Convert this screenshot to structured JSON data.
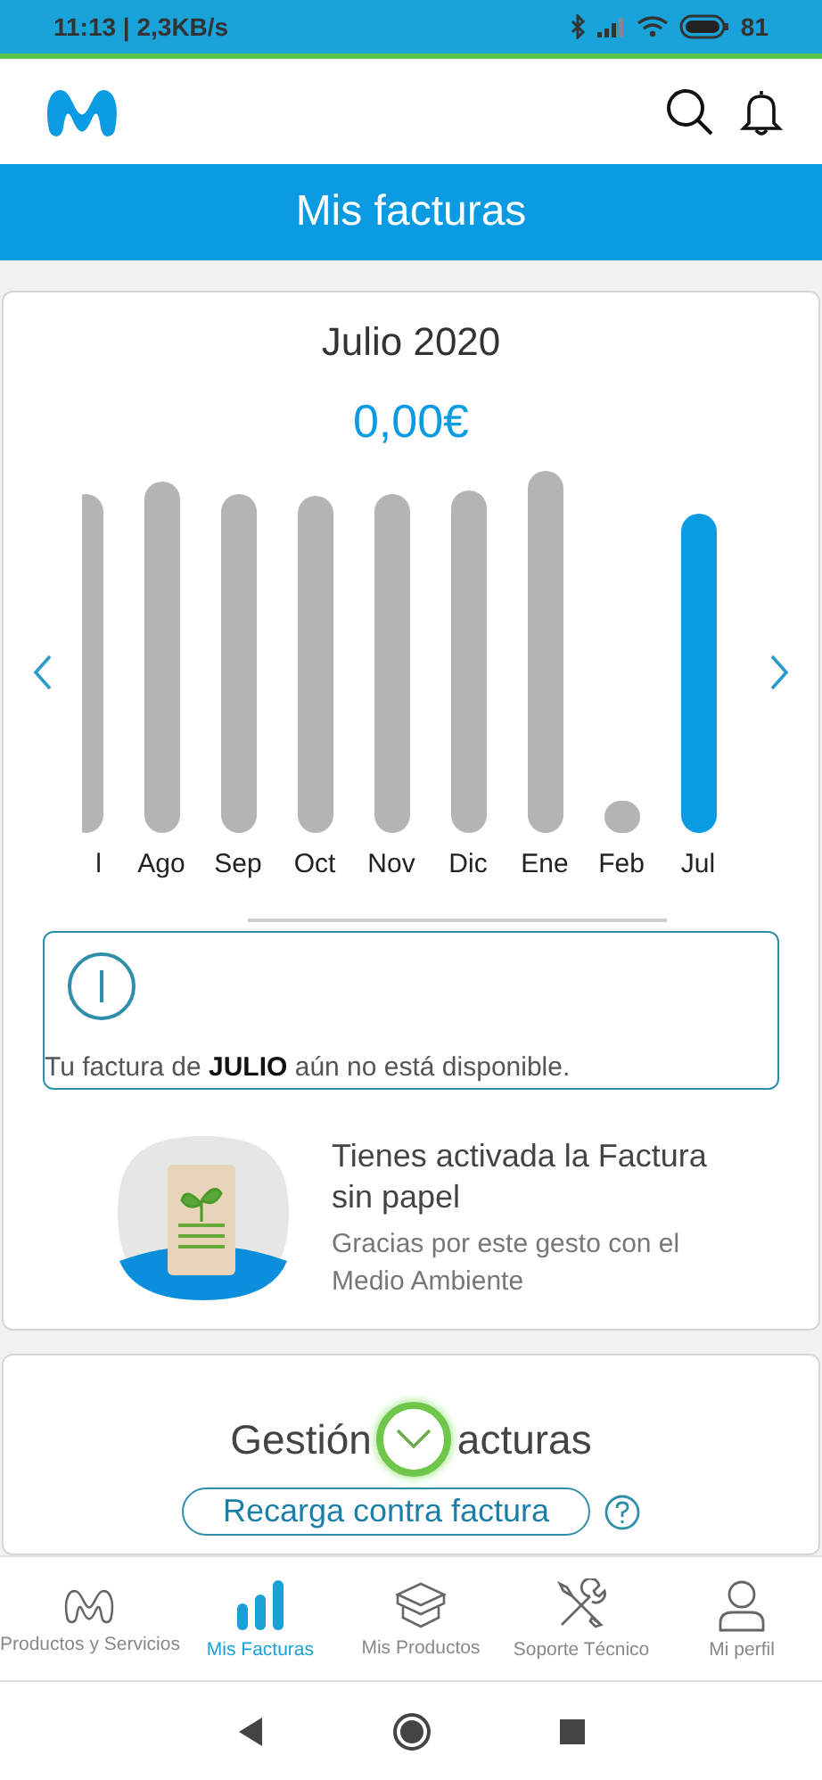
{
  "status_bar": {
    "time": "11:13 | 2,3KB/s",
    "battery": "81"
  },
  "page_title": "Mis facturas",
  "invoice": {
    "period": "Julio 2020",
    "amount": "0,00€"
  },
  "bars": [
    {
      "label": "l",
      "selected": false
    },
    {
      "label": "Ago",
      "selected": false
    },
    {
      "label": "Sep",
      "selected": false
    },
    {
      "label": "Oct",
      "selected": false
    },
    {
      "label": "Nov",
      "selected": false
    },
    {
      "label": "Dic",
      "selected": false
    },
    {
      "label": "Ene",
      "selected": false
    },
    {
      "label": "Feb",
      "selected": false
    },
    {
      "label": "Jul",
      "selected": true
    }
  ],
  "notice": {
    "text": "Tu factura de **JULIO** aún no está disponible."
  },
  "paperless": {
    "title": "Tienes activada la Factura sin papel",
    "subtitle": "Gracias por este gesto con el Medio Ambiente"
  },
  "management": {
    "title_start": "Gestión",
    "title_end": "acturas",
    "button": "Recarga contra factura"
  },
  "bottom_nav": [
    {
      "label": "Productos y Servicios",
      "kind": "logo",
      "selected": false
    },
    {
      "label": "Mis Facturas",
      "kind": "bars",
      "selected": true
    },
    {
      "label": "Mis Productos",
      "kind": "box",
      "selected": false
    },
    {
      "label": "Soporte Técnico",
      "kind": "tools",
      "selected": false
    },
    {
      "label": "Mi perfil",
      "kind": "user",
      "selected": false
    }
  ]
}
